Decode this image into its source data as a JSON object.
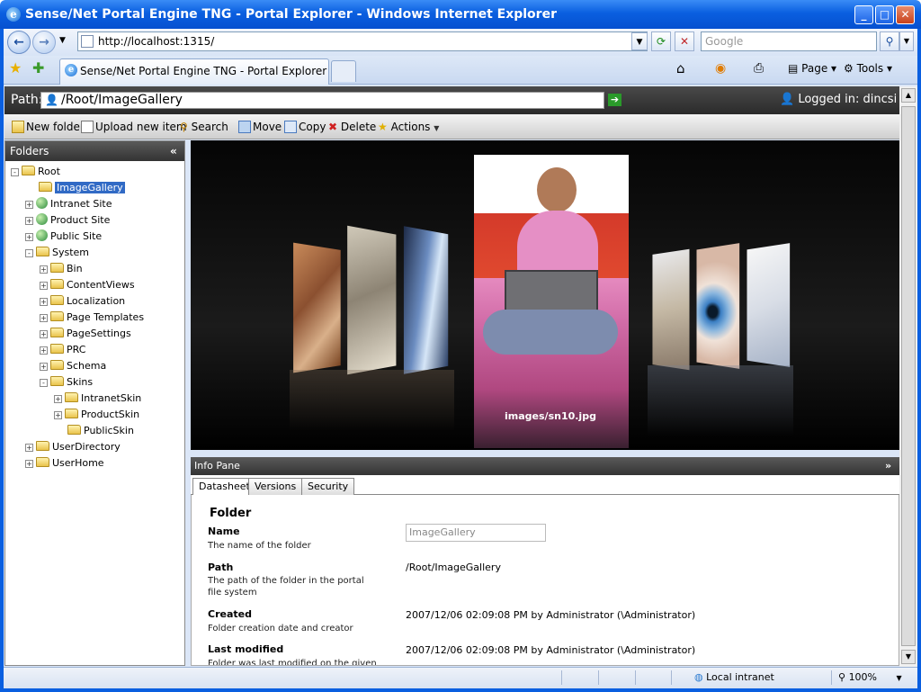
{
  "window": {
    "title": "Sense/Net Portal Engine TNG - Portal Explorer - Windows Internet Explorer"
  },
  "browser": {
    "address": "http://localhost:1315/",
    "search_placeholder": "Google",
    "tab_title": "Sense/Net Portal Engine TNG - Portal Explorer",
    "commands": {
      "page": "Page",
      "tools": "Tools"
    },
    "status": {
      "zone": "Local intranet",
      "zoom": "100%"
    }
  },
  "portal": {
    "path_label": "Path:",
    "path_value": "/Root/ImageGallery",
    "logged_in": "Logged in: dincsi",
    "toolbar": {
      "new_folder": "New folder",
      "upload": "Upload new item",
      "search": "Search",
      "move": "Move",
      "copy": "Copy",
      "delete": "Delete",
      "actions": "Actions"
    },
    "folders_title": "Folders",
    "tree": [
      {
        "label": "Root",
        "level": 0,
        "exp": "-",
        "icon": "folder"
      },
      {
        "label": "ImageGallery",
        "level": 1,
        "exp": "",
        "icon": "folder",
        "selected": true
      },
      {
        "label": "Intranet Site",
        "level": 1,
        "exp": "+",
        "icon": "globe"
      },
      {
        "label": "Product Site",
        "level": 1,
        "exp": "+",
        "icon": "globe"
      },
      {
        "label": "Public Site",
        "level": 1,
        "exp": "+",
        "icon": "globe"
      },
      {
        "label": "System",
        "level": 1,
        "exp": "-",
        "icon": "folder"
      },
      {
        "label": "Bin",
        "level": 2,
        "exp": "+",
        "icon": "folder"
      },
      {
        "label": "ContentViews",
        "level": 2,
        "exp": "+",
        "icon": "folder"
      },
      {
        "label": "Localization",
        "level": 2,
        "exp": "+",
        "icon": "folder"
      },
      {
        "label": "Page Templates",
        "level": 2,
        "exp": "+",
        "icon": "folder"
      },
      {
        "label": "PageSettings",
        "level": 2,
        "exp": "+",
        "icon": "folder"
      },
      {
        "label": "PRC",
        "level": 2,
        "exp": "+",
        "icon": "folder"
      },
      {
        "label": "Schema",
        "level": 2,
        "exp": "+",
        "icon": "folder"
      },
      {
        "label": "Skins",
        "level": 2,
        "exp": "-",
        "icon": "folder"
      },
      {
        "label": "IntranetSkin",
        "level": 3,
        "exp": "+",
        "icon": "folder"
      },
      {
        "label": "ProductSkin",
        "level": 3,
        "exp": "+",
        "icon": "folder"
      },
      {
        "label": "PublicSkin",
        "level": 3,
        "exp": "",
        "icon": "folder"
      },
      {
        "label": "UserDirectory",
        "level": 1,
        "exp": "+",
        "icon": "folder"
      },
      {
        "label": "UserHome",
        "level": 1,
        "exp": "+",
        "icon": "folder"
      }
    ],
    "gallery": {
      "caption": "images/sn10.jpg"
    },
    "info": {
      "title": "Info Pane",
      "tabs": [
        "Datasheet",
        "Versions",
        "Security"
      ],
      "heading": "Folder",
      "fields": {
        "name": {
          "label": "Name",
          "desc": "The name of the folder",
          "value": "ImageGallery"
        },
        "path": {
          "label": "Path",
          "desc": "The path of the folder in the portal file system",
          "value": "/Root/ImageGallery"
        },
        "created": {
          "label": "Created",
          "desc": "Folder creation date and creator",
          "value": "2007/12/06 02:09:08 PM by Administrator (\\Administrator)"
        },
        "modified": {
          "label": "Last modified",
          "desc": "Folder was last modified on the given",
          "value": "2007/12/06 02:09:08 PM by Administrator (\\Administrator)"
        }
      }
    }
  }
}
